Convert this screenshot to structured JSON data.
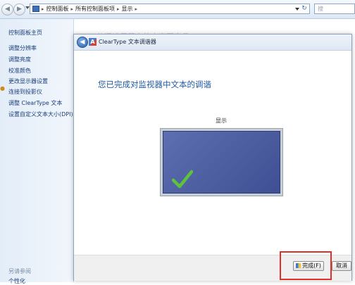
{
  "explorer": {
    "breadcrumbs": [
      "控制面板",
      "所有控制面板项",
      "显示"
    ],
    "search_placeholder": "搜"
  },
  "sidebar": {
    "home_link": "控制面板主页",
    "items": [
      "调整分辨率",
      "调整亮度",
      "校准颜色",
      "更改显示器设置",
      "连接到投影仪",
      "调整 ClearType 文本",
      "设置自定义文本大小(DPI)"
    ],
    "see_also": "另请参阅",
    "bottom_item": "个性化"
  },
  "background": {
    "heading": "使阅读屏幕上的内容更容易"
  },
  "dialog": {
    "title": "ClearType 文本调谐器",
    "heading": "您已完成对监视器中文本的调谐",
    "monitor_label": "显示",
    "finish_button": "完成(F)",
    "cancel_button": "取消"
  },
  "colors": {
    "accent_blue": "#1f5aa6",
    "highlight_red": "#e0302a",
    "screen_blue": "#4a5aa0",
    "check_green": "#5fc33a"
  },
  "icons": {
    "back": "back-arrow-icon",
    "forward": "forward-arrow-icon",
    "app": "cleartype-icon",
    "check": "check-icon",
    "shield": "uac-shield-icon"
  }
}
